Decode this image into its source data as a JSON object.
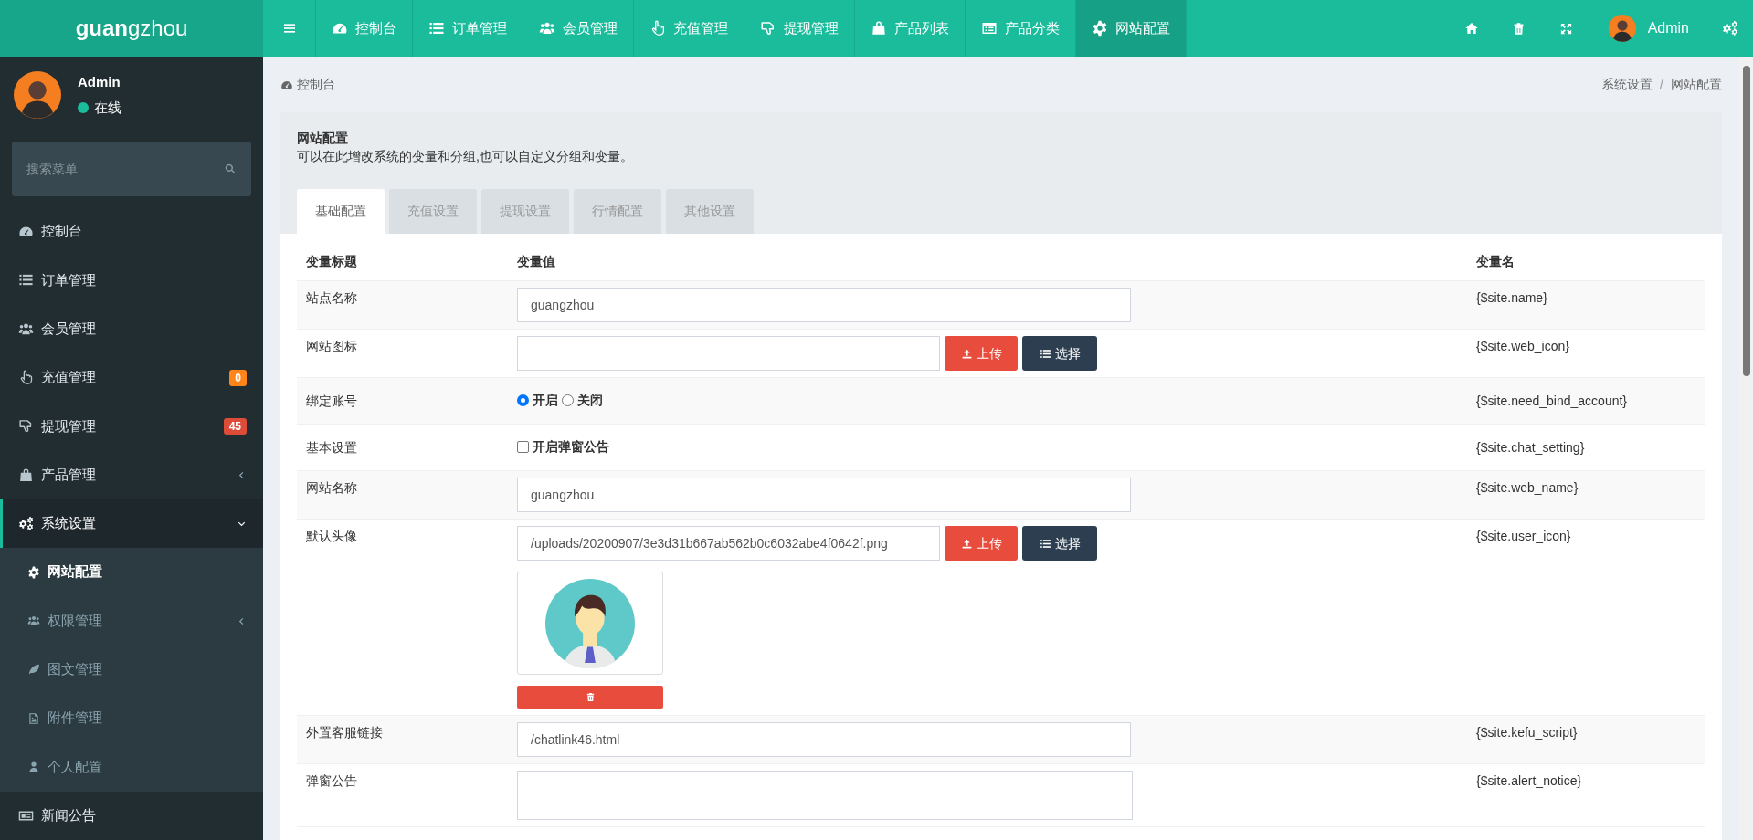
{
  "topbar": {
    "logo": "**guan**gzhou",
    "nav": [
      {
        "label": "控制台",
        "selected": false
      },
      {
        "label": "订单管理",
        "selected": false
      },
      {
        "label": "会员管理",
        "selected": false
      },
      {
        "label": "充值管理",
        "selected": false
      },
      {
        "label": "提现管理",
        "selected": false
      },
      {
        "label": "产品列表",
        "selected": false
      },
      {
        "label": "产品分类",
        "selected": false
      },
      {
        "label": "网站配置",
        "selected": true
      }
    ],
    "user": "Admin"
  },
  "sidebar": {
    "user": {
      "name": "Admin",
      "status": "在线"
    },
    "search": {
      "placeholder": "搜索菜单"
    },
    "items": [
      {
        "label": "控制台",
        "selected": false
      },
      {
        "label": "订单管理",
        "selected": false
      },
      {
        "label": "会员管理",
        "selected": false
      },
      {
        "label": "充值管理",
        "selected": false,
        "badge": "0",
        "color": "#ff851b"
      },
      {
        "label": "提现管理",
        "selected": false,
        "badge": "45",
        "color": "#dd4b39"
      },
      {
        "label": "产品管理",
        "selected": false,
        "expanded": false
      },
      {
        "label": "系统设置",
        "selected": true,
        "expanded": true,
        "children": [
          {
            "label": "网站配置",
            "selected": true
          },
          {
            "label": "权限管理",
            "selected": false,
            "expanded": false
          },
          {
            "label": "图文管理",
            "selected": false
          },
          {
            "label": "附件管理",
            "selected": false
          },
          {
            "label": "个人配置",
            "selected": false
          }
        ]
      },
      {
        "label": "新闻公告",
        "selected": false
      }
    ]
  },
  "breadcrumb": {
    "home": "控制台",
    "separator": "/",
    "trail": [
      "系统设置",
      "网站配置"
    ]
  },
  "panel": {
    "title": "网站配置",
    "description": "可以在此增改系统的变量和分组,也可以自定义分组和变量。",
    "tabs": [
      {
        "label": "基础配置",
        "selected": true
      },
      {
        "label": "充值设置",
        "selected": false
      },
      {
        "label": "提现设置",
        "selected": false
      },
      {
        "label": "行情配置",
        "selected": false
      },
      {
        "label": "其他设置",
        "selected": false
      }
    ],
    "table": {
      "columns": [
        "变量标题",
        "变量值",
        "变量名"
      ],
      "rows": [
        {
          "kind": "text",
          "title": "站点名称",
          "value": "guangzhou",
          "variable": "{$site.name}"
        },
        {
          "kind": "upload",
          "title": "网站图标",
          "upload_label": "上传",
          "choose_label": "选择",
          "variable": "{$site.web_icon}"
        },
        {
          "kind": "radio",
          "title": "绑定账号",
          "options": [
            {
              "label": "开启",
              "selected": true
            },
            {
              "label": "关闭",
              "selected": false
            }
          ],
          "variable": "{$site.need_bind_account}"
        },
        {
          "kind": "checkbox",
          "title": "基本设置",
          "label": "开启弹窗公告",
          "checked": false,
          "variable": "{$site.chat_setting}"
        },
        {
          "kind": "text",
          "title": "网站名称",
          "value": "guangzhou",
          "variable": "{$site.web_name}"
        },
        {
          "kind": "upload",
          "title": "默认头像",
          "value": "/uploads/20200907/3e3d31b667ab562b0c6032abe4f0642f.png",
          "upload_label": "上传",
          "choose_label": "选择",
          "preview": true,
          "variable": "{$site.user_icon}"
        },
        {
          "kind": "text",
          "title": "外置客服链接",
          "value": "/chatlink46.html",
          "variable": "{$site.kefu_script}"
        },
        {
          "kind": "textarea",
          "title": "弹窗公告",
          "variable": "{$site.alert_notice}"
        }
      ]
    }
  }
}
